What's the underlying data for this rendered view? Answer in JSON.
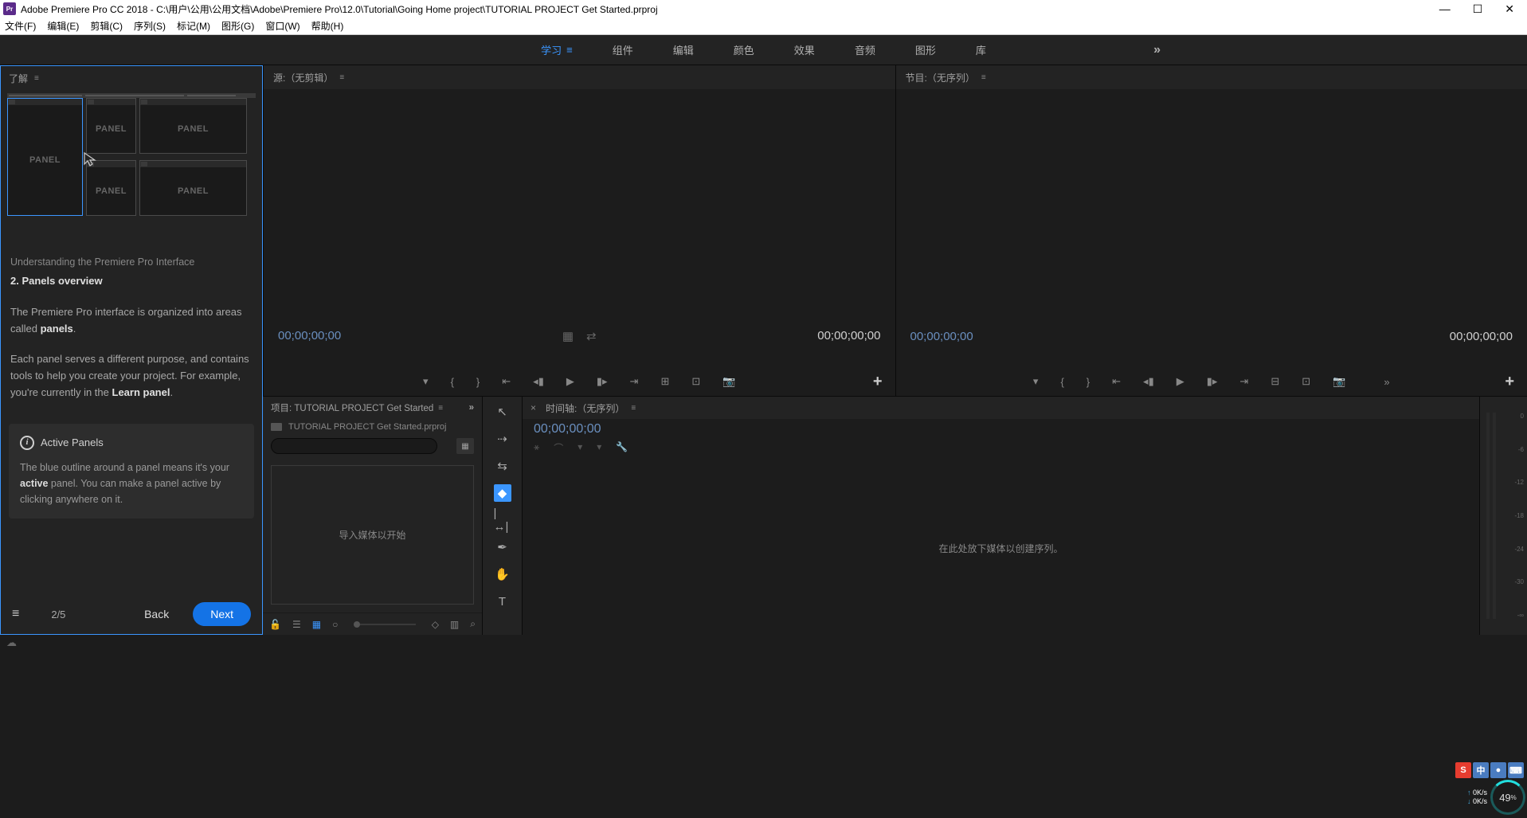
{
  "titlebar": {
    "app_icon_text": "Pr",
    "title": "Adobe Premiere Pro CC 2018 - C:\\用户\\公用\\公用文档\\Adobe\\Premiere Pro\\12.0\\Tutorial\\Going Home project\\TUTORIAL PROJECT Get Started.prproj"
  },
  "menubar": [
    "文件(F)",
    "编辑(E)",
    "剪辑(C)",
    "序列(S)",
    "标记(M)",
    "图形(G)",
    "窗口(W)",
    "帮助(H)"
  ],
  "workspaces": {
    "items": [
      "学习",
      "组件",
      "编辑",
      "颜色",
      "效果",
      "音频",
      "图形",
      "库"
    ],
    "active": 0,
    "overflow": "»"
  },
  "learn": {
    "header": "了解",
    "panel_word": "PANEL",
    "subtitle": "Understanding the Premiere Pro Interface",
    "step_title": "2. Panels overview",
    "para1_a": "The Premiere Pro interface is organized into areas called ",
    "para1_b": "panels",
    "para1_c": ".",
    "para2_a": "Each panel serves a different purpose, and contains tools to help you create your project. For example, you're currently in the ",
    "para2_b": "Learn panel",
    "para2_c": ".",
    "info_title": "Active Panels",
    "info_body_a": "The blue outline around a panel means it's your ",
    "info_body_b": "active",
    "info_body_c": " panel. You can make a panel active by clicking anywhere on it.",
    "counter": "2/5",
    "back": "Back",
    "next": "Next"
  },
  "source": {
    "title": "源:（无剪辑）",
    "tc_left": "00;00;00;00",
    "tc_right": "00;00;00;00"
  },
  "program": {
    "title": "节目:（无序列）",
    "tc_left": "00;00;00;00",
    "tc_right": "00;00;00;00"
  },
  "project": {
    "tab": "项目: TUTORIAL PROJECT Get Started",
    "overflow": "»",
    "filename": "TUTORIAL PROJECT Get Started.prproj",
    "search_placeholder": "",
    "import_text": "导入媒体以开始"
  },
  "timeline": {
    "title": "时间轴:（无序列）",
    "tc": "00;00;00;00",
    "drop_text": "在此处放下媒体以创建序列。"
  },
  "meter": {
    "scale": [
      "0",
      "-6",
      "-12",
      "-18",
      "-24",
      "-30",
      "-∞"
    ]
  },
  "overlay": {
    "up": "0K/s",
    "dn": "0K/s",
    "pct": "49",
    "pct_unit": "%",
    "ime_s": "S",
    "ime_c": "中",
    "ime_k": "⌨",
    "ime_d": "●"
  }
}
